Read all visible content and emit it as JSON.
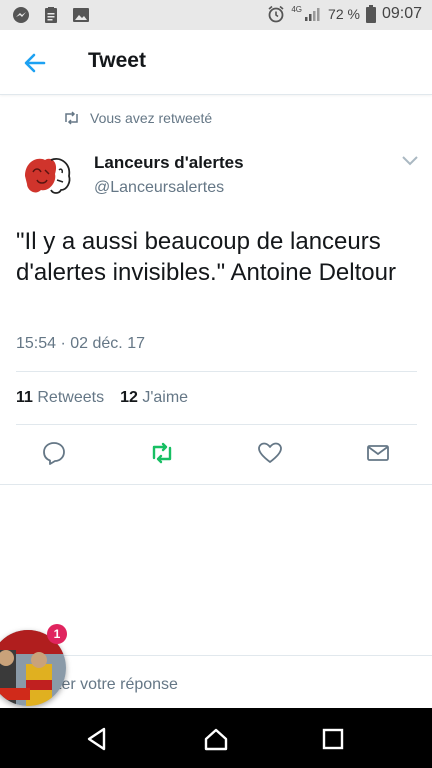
{
  "status": {
    "network": "4G",
    "battery": "72 %",
    "time": "09:07",
    "left_icons": [
      "messenger-icon",
      "clipboard-icon",
      "image-icon"
    ]
  },
  "header": {
    "title": "Tweet"
  },
  "retweet_notice": "Vous avez retweeté",
  "author": {
    "name": "Lanceurs d'alertes",
    "handle": "@Lanceursalertes"
  },
  "tweet": {
    "text": "\"Il y a aussi beaucoup de lanceurs d'alertes invisibles.\" Antoine Deltour",
    "timestamp": "15:54 · 02 déc. 17"
  },
  "stats": {
    "retweets_count": "11",
    "retweets_label": "Retweets",
    "likes_count": "12",
    "likes_label": "J'aime"
  },
  "actions": [
    "reply-icon",
    "retweet-icon",
    "like-icon",
    "share-icon"
  ],
  "colors": {
    "accent": "#1da1f2",
    "retweet_active": "#17bf63",
    "muted": "#657786",
    "badge": "#e0245e"
  },
  "reply": {
    "placeholder_visible": "ter votre réponse",
    "chat_badge": "1"
  },
  "navbar": [
    "back-icon",
    "home-icon",
    "recents-icon"
  ]
}
